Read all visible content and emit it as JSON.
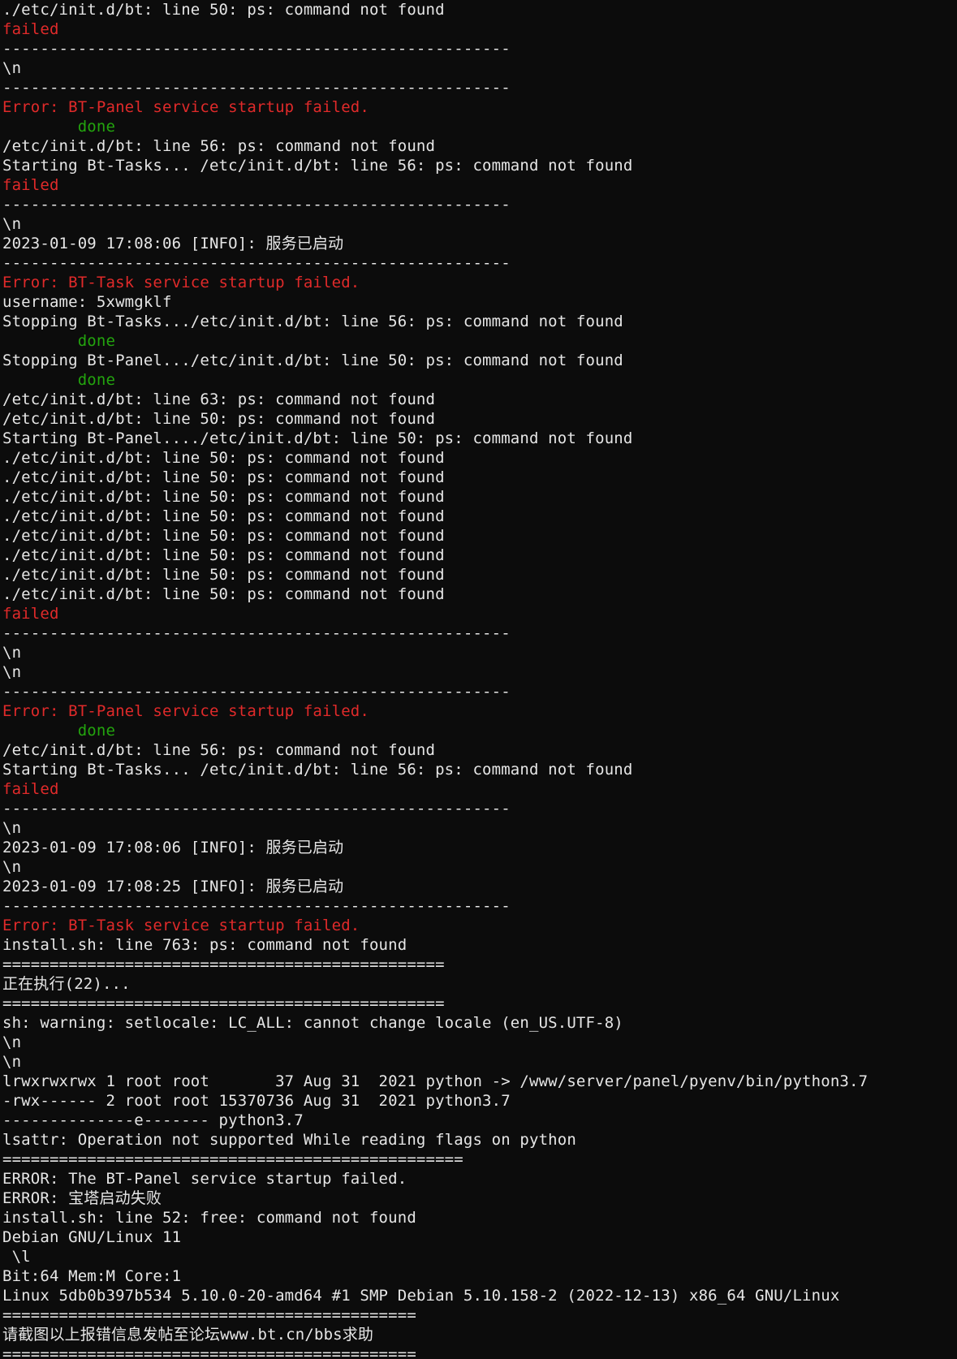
{
  "window": {
    "background": "#0c0c0c",
    "text_color": "#e6e6e6",
    "error_color": "#e02a2a",
    "done_color": "#23a40e",
    "highlight_background": "#3a3a3a"
  },
  "lines": [
    {
      "text": "./etc/init.d/bt: line 50: ps: command not found",
      "style": "plain"
    },
    {
      "text": "failed",
      "style": "red"
    },
    {
      "text": "------------------------------------------------------",
      "style": "plain"
    },
    {
      "text": "\\n",
      "style": "plain"
    },
    {
      "text": "------------------------------------------------------",
      "style": "plain"
    },
    {
      "text": "Error: BT-Panel service startup failed.",
      "style": "red"
    },
    {
      "text": "        done",
      "style": "green"
    },
    {
      "text": "/etc/init.d/bt: line 56: ps: command not found",
      "style": "plain"
    },
    {
      "text": "Starting Bt-Tasks... /etc/init.d/bt: line 56: ps: command not found",
      "style": "plain"
    },
    {
      "text": "failed",
      "style": "red"
    },
    {
      "text": "------------------------------------------------------",
      "style": "plain"
    },
    {
      "text": "\\n",
      "style": "plain"
    },
    {
      "text": "2023-01-09 17:08:06 [INFO]: 服务已启动",
      "style": "plain"
    },
    {
      "text": "------------------------------------------------------",
      "style": "plain"
    },
    {
      "text": "Error: BT-Task service startup failed.",
      "style": "red"
    },
    {
      "text": "username: 5xwmgklf",
      "style": "plain"
    },
    {
      "text": "Stopping Bt-Tasks.../etc/init.d/bt: line 56: ps: command not found",
      "style": "plain"
    },
    {
      "text": "        done",
      "style": "green"
    },
    {
      "text": "Stopping Bt-Panel.../etc/init.d/bt: line 50: ps: command not found",
      "style": "plain"
    },
    {
      "text": "        done",
      "style": "green"
    },
    {
      "text": "/etc/init.d/bt: line 63: ps: command not found",
      "style": "plain"
    },
    {
      "text": "/etc/init.d/bt: line 50: ps: command not found",
      "style": "plain"
    },
    {
      "text": "Starting Bt-Panel..../etc/init.d/bt: line 50: ps: command not found",
      "style": "plain"
    },
    {
      "text": "./etc/init.d/bt: line 50: ps: command not found",
      "style": "plain"
    },
    {
      "text": "./etc/init.d/bt: line 50: ps: command not found",
      "style": "plain"
    },
    {
      "text": "./etc/init.d/bt: line 50: ps: command not found",
      "style": "plain"
    },
    {
      "text": "./etc/init.d/bt: line 50: ps: command not found",
      "style": "plain"
    },
    {
      "text": "./etc/init.d/bt: line 50: ps: command not found",
      "style": "plain"
    },
    {
      "text": "./etc/init.d/bt: line 50: ps: command not found",
      "style": "plain"
    },
    {
      "text": "./etc/init.d/bt: line 50: ps: command not found",
      "style": "plain"
    },
    {
      "text": "./etc/init.d/bt: line 50: ps: command not found",
      "style": "plain"
    },
    {
      "text": "failed",
      "style": "red"
    },
    {
      "text": "------------------------------------------------------",
      "style": "plain"
    },
    {
      "text": "\\n",
      "style": "plain"
    },
    {
      "text": "\\n",
      "style": "plain"
    },
    {
      "text": "------------------------------------------------------",
      "style": "plain"
    },
    {
      "text": "Error: BT-Panel service startup failed.",
      "style": "red"
    },
    {
      "text": "        done",
      "style": "green"
    },
    {
      "text": "/etc/init.d/bt: line 56: ps: command not found",
      "style": "plain"
    },
    {
      "text": "Starting Bt-Tasks... /etc/init.d/bt: line 56: ps: command not found",
      "style": "plain"
    },
    {
      "text": "failed",
      "style": "red"
    },
    {
      "text": "------------------------------------------------------",
      "style": "plain"
    },
    {
      "text": "\\n",
      "style": "plain"
    },
    {
      "text": "2023-01-09 17:08:06 [INFO]: 服务已启动",
      "style": "plain"
    },
    {
      "text": "\\n",
      "style": "plain"
    },
    {
      "text": "2023-01-09 17:08:25 [INFO]: 服务已启动",
      "style": "plain"
    },
    {
      "text": "------------------------------------------------------",
      "style": "plain"
    },
    {
      "text": "Error: BT-Task service startup failed.",
      "style": "red"
    },
    {
      "text": "install.sh: line 763: ps: command not found",
      "style": "plain"
    },
    {
      "text": "===============================================",
      "style": "plain"
    },
    {
      "text": "正在执行(22)...",
      "style": "plain"
    },
    {
      "text": "===============================================",
      "style": "plain"
    },
    {
      "text": "sh: warning: setlocale: LC_ALL: cannot change locale (en_US.UTF-8)",
      "style": "plain"
    },
    {
      "text": "\\n",
      "style": "plain"
    },
    {
      "text": "\\n",
      "style": "plain"
    },
    {
      "text": "lrwxrwxrwx 1 root root       37 Aug 31  2021 python -> /www/server/panel/pyenv/bin/python3.7",
      "style": "plain"
    },
    {
      "text": "-rwx------ 2 root root 15370736 Aug 31  2021 python3.7",
      "style": "plain"
    },
    {
      "text": "--------------e------- python3.7",
      "style": "plain"
    },
    {
      "text": "lsattr: Operation not supported While reading flags on python",
      "style": "plain"
    },
    {
      "text": "=================================================",
      "style": "plain"
    },
    {
      "text": "ERROR: The BT-Panel service startup failed.",
      "style": "highlight"
    },
    {
      "text": "ERROR: 宝塔启动失败",
      "style": "highlight"
    },
    {
      "text": "install.sh: line 52: free: command not found",
      "style": "plain"
    },
    {
      "text": "Debian GNU/Linux 11",
      "style": "plain"
    },
    {
      "text": " \\l",
      "style": "plain"
    },
    {
      "text": "Bit:64 Mem:M Core:1",
      "style": "plain"
    },
    {
      "text": "Linux 5db0b397b534 5.10.0-20-amd64 #1 SMP Debian 5.10.158-2 (2022-12-13) x86_64 GNU/Linux",
      "style": "plain"
    },
    {
      "text": "============================================",
      "style": "plain"
    },
    {
      "text": "请截图以上报错信息发帖至论坛www.bt.cn/bbs求助",
      "style": "plain"
    },
    {
      "text": "============================================",
      "style": "plain"
    }
  ]
}
